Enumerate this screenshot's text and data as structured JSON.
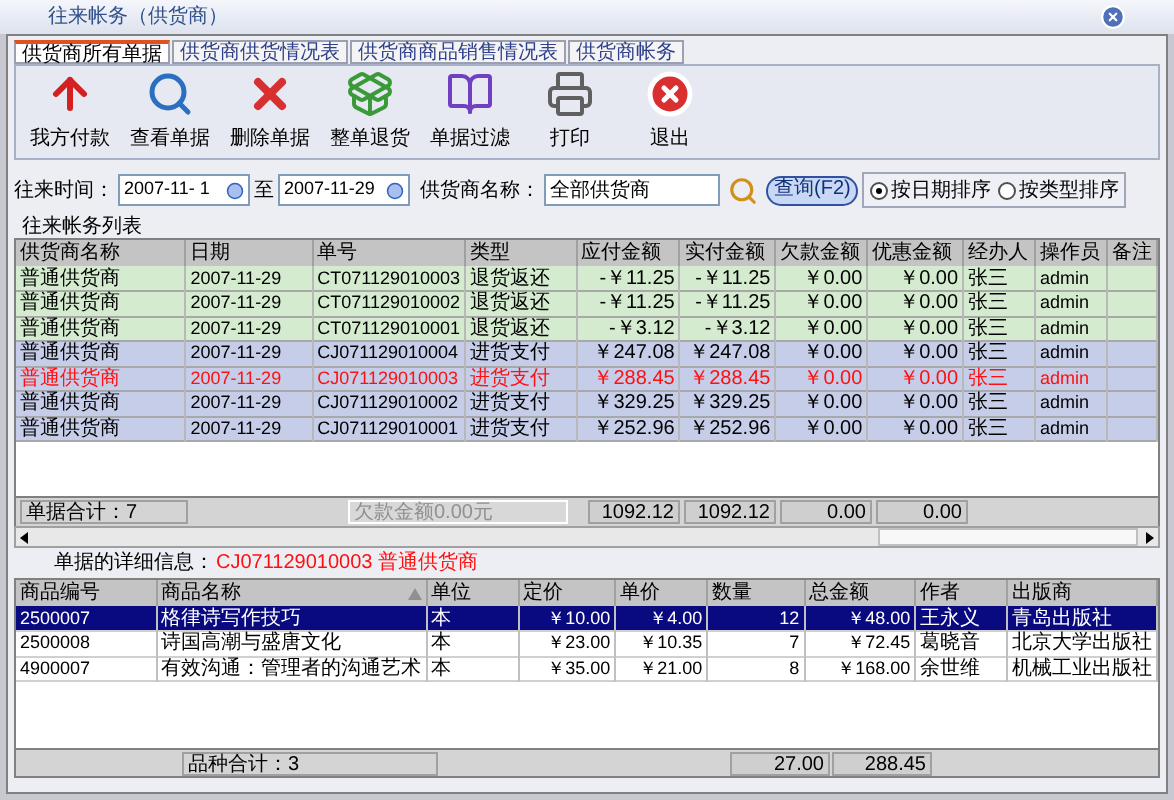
{
  "window": {
    "title": "往来帐务（供货商）"
  },
  "tabs": [
    {
      "label": "供货商所有单据",
      "selected": true
    },
    {
      "label": "供货商供货情况表",
      "selected": false
    },
    {
      "label": "供货商商品销售情况表",
      "selected": false
    },
    {
      "label": "供货商帐务",
      "selected": false
    }
  ],
  "toolbar": [
    {
      "label": "我方付款",
      "kind": "pay"
    },
    {
      "label": "查看单据",
      "kind": "view"
    },
    {
      "label": "删除单据",
      "kind": "delete"
    },
    {
      "label": "整单退货",
      "kind": "return"
    },
    {
      "label": "单据过滤",
      "kind": "filter"
    },
    {
      "label": "打印",
      "kind": "print"
    },
    {
      "label": "退出",
      "kind": "exit"
    }
  ],
  "filter": {
    "time_label": "往来时间：",
    "from_date": "2007-11- 1",
    "to_label": "至",
    "to_date": "2007-11-29",
    "supplier_label": "供货商名称：",
    "supplier_value": "全部供货商",
    "query_button": "查询(F2)",
    "sort_options": [
      {
        "label": "按日期排序",
        "selected": true
      },
      {
        "label": "按类型排序",
        "selected": false
      }
    ]
  },
  "list": {
    "title": "往来帐务列表",
    "columns": [
      "供货商名称",
      "日期",
      "单号",
      "类型",
      "应付金额",
      "实付金额",
      "欠款金额",
      "优惠金额",
      "经办人",
      "操作员",
      "备注"
    ],
    "rows": [
      {
        "kind": "return",
        "selected": false,
        "cells": [
          "普通供货商",
          "2007-11-29",
          "CT071129010003",
          "退货返还",
          "-￥11.25",
          "-￥11.25",
          "￥0.00",
          "￥0.00",
          "张三",
          "admin"
        ]
      },
      {
        "kind": "return",
        "selected": false,
        "cells": [
          "普通供货商",
          "2007-11-29",
          "CT071129010002",
          "退货返还",
          "-￥11.25",
          "-￥11.25",
          "￥0.00",
          "￥0.00",
          "张三",
          "admin"
        ]
      },
      {
        "kind": "return",
        "selected": false,
        "cells": [
          "普通供货商",
          "2007-11-29",
          "CT071129010001",
          "退货返还",
          "-￥3.12",
          "-￥3.12",
          "￥0.00",
          "￥0.00",
          "张三",
          "admin"
        ]
      },
      {
        "kind": "purchase",
        "selected": false,
        "cells": [
          "普通供货商",
          "2007-11-29",
          "CJ071129010004",
          "进货支付",
          "￥247.08",
          "￥247.08",
          "￥0.00",
          "￥0.00",
          "张三",
          "admin"
        ]
      },
      {
        "kind": "purchase",
        "selected": true,
        "cells": [
          "普通供货商",
          "2007-11-29",
          "CJ071129010003",
          "进货支付",
          "￥288.45",
          "￥288.45",
          "￥0.00",
          "￥0.00",
          "张三",
          "admin"
        ]
      },
      {
        "kind": "purchase",
        "selected": false,
        "cells": [
          "普通供货商",
          "2007-11-29",
          "CJ071129010002",
          "进货支付",
          "￥329.25",
          "￥329.25",
          "￥0.00",
          "￥0.00",
          "张三",
          "admin"
        ]
      },
      {
        "kind": "purchase",
        "selected": false,
        "cells": [
          "普通供货商",
          "2007-11-29",
          "CJ071129010001",
          "进货支付",
          "￥252.96",
          "￥252.96",
          "￥0.00",
          "￥0.00",
          "张三",
          "admin"
        ]
      }
    ],
    "count": "单据合计：7",
    "debt": "欠款金额0.00元",
    "totals": [
      "1092.12",
      "1092.12",
      "0.00",
      "0.00"
    ]
  },
  "detail": {
    "label": "单据的详细信息：",
    "value": "CJ071129010003 普通供货商",
    "columns": [
      {
        "label": "商品编号",
        "sorted": false
      },
      {
        "label": "商品名称",
        "sorted": true
      },
      {
        "label": "单位",
        "sorted": false
      },
      {
        "label": "定价",
        "sorted": false
      },
      {
        "label": "单价",
        "sorted": false
      },
      {
        "label": "数量",
        "sorted": false
      },
      {
        "label": "总金额",
        "sorted": false
      },
      {
        "label": "作者",
        "sorted": false
      },
      {
        "label": "出版商",
        "sorted": false
      }
    ],
    "rows": [
      {
        "selected": true,
        "cells": [
          "2500007",
          "格律诗写作技巧",
          "本",
          "￥10.00",
          "￥4.00",
          "12",
          "￥48.00",
          "王永义",
          "青岛出版社"
        ]
      },
      {
        "selected": false,
        "cells": [
          "2500008",
          "诗国高潮与盛唐文化",
          "本",
          "￥23.00",
          "￥10.35",
          "7",
          "￥72.45",
          "葛晓音",
          "北京大学出版社"
        ]
      },
      {
        "selected": false,
        "cells": [
          "4900007",
          "有效沟通：管理者的沟通艺术",
          "本",
          "￥35.00",
          "￥21.00",
          "8",
          "￥168.00",
          "余世维",
          "机械工业出版社"
        ]
      }
    ],
    "count": "品种合计：3",
    "totals": [
      "27.00",
      "288.45"
    ]
  }
}
